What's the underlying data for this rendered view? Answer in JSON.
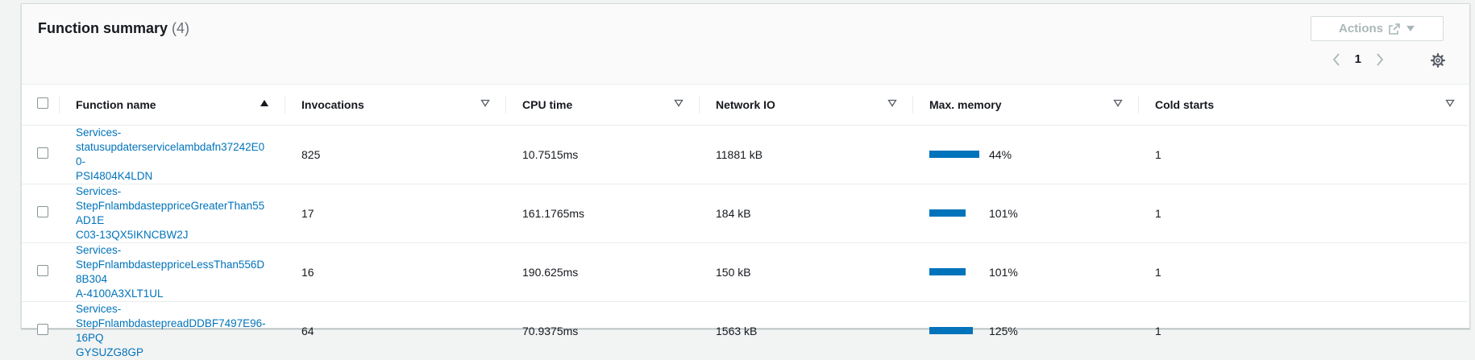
{
  "header": {
    "title": "Function summary",
    "count": "(4)",
    "actions_label": "Actions",
    "page_number": "1"
  },
  "columns": [
    {
      "label": "Function name",
      "sort": "ascending"
    },
    {
      "label": "Invocations",
      "sort": "none"
    },
    {
      "label": "CPU time",
      "sort": "none"
    },
    {
      "label": "Network IO",
      "sort": "none"
    },
    {
      "label": "Max. memory",
      "sort": "none"
    },
    {
      "label": "Cold starts",
      "sort": "none"
    }
  ],
  "rows": [
    {
      "name_lines": [
        "Services-",
        "statusupdaterservicelambdafn37242E00-",
        "PSI4804K4LDN"
      ],
      "invocations": "825",
      "cpu_time": "10.7515ms",
      "network_io": "11881 kB",
      "max_memory_pct": 44,
      "max_memory_label": "44%",
      "cold_starts": "1"
    },
    {
      "name_lines": [
        "Services-",
        "StepFnlambdasteppriceGreaterThan55AD1E",
        "C03-13QX5IKNCBW2J"
      ],
      "invocations": "17",
      "cpu_time": "161.1765ms",
      "network_io": "184 kB",
      "max_memory_pct": 101,
      "max_memory_label": "101%",
      "cold_starts": "1"
    },
    {
      "name_lines": [
        "Services-",
        "StepFnlambdasteppriceLessThan556D8B304",
        "A-4100A3XLT1UL"
      ],
      "invocations": "16",
      "cpu_time": "190.625ms",
      "network_io": "150 kB",
      "max_memory_pct": 101,
      "max_memory_label": "101%",
      "cold_starts": "1"
    },
    {
      "name_lines": [
        "Services-",
        "StepFnlambdastepreadDDBF7497E96-16PQ",
        "GYSUZG8GP"
      ],
      "invocations": "64",
      "cpu_time": "70.9375ms",
      "network_io": "1563 kB",
      "max_memory_pct": 125,
      "max_memory_label": "125%",
      "cold_starts": "1"
    }
  ],
  "colors": {
    "link": "#0073bb",
    "bar": "#0073bb",
    "disabled": "#aab7b8"
  },
  "icons": {
    "actions": "external-link-icon",
    "dropdown": "caret-down-icon",
    "pager_prev": "chevron-left-icon",
    "pager_next": "chevron-right-icon",
    "preferences": "gear-icon"
  }
}
